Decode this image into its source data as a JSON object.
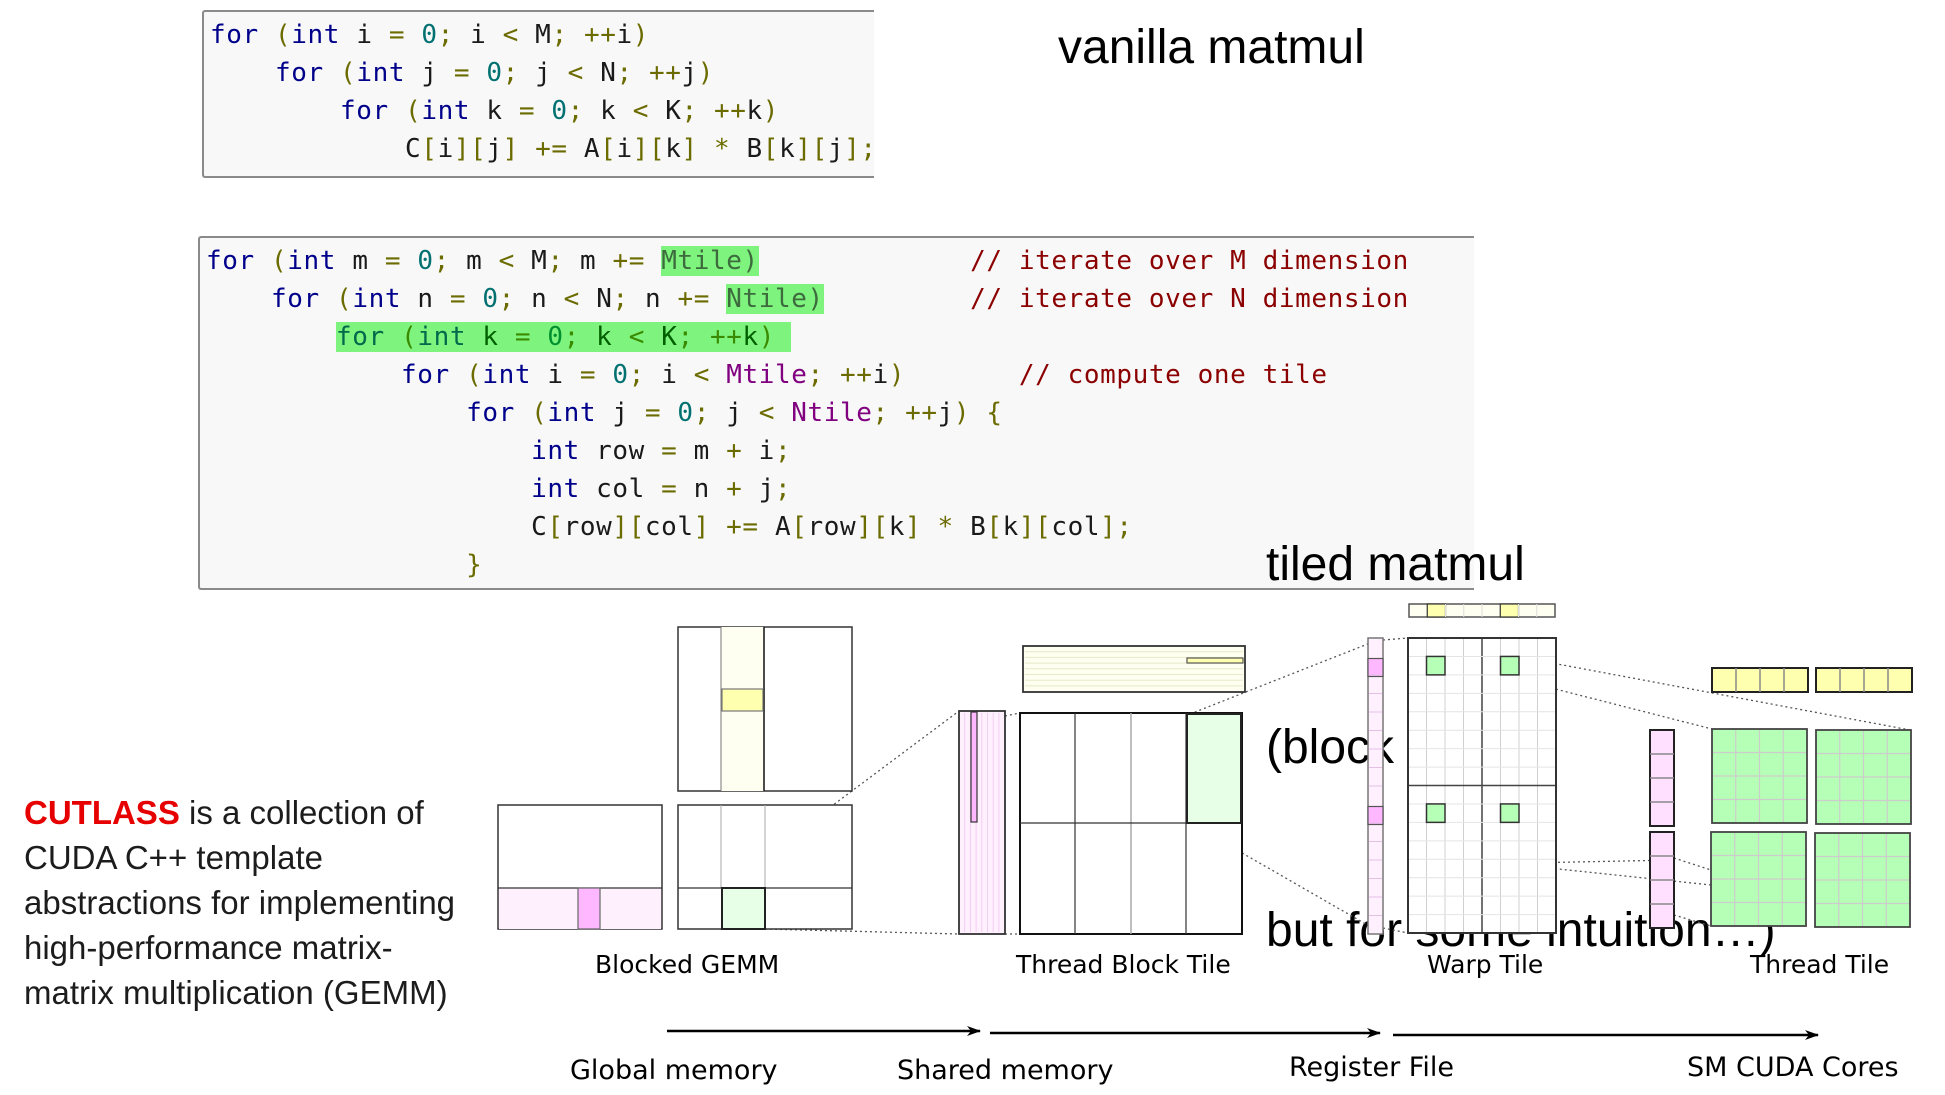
{
  "vanilla": {
    "title": "vanilla matmul",
    "code": [
      [
        [
          "kw",
          "for"
        ],
        [
          "var",
          " "
        ],
        [
          "pn",
          "("
        ],
        [
          "kw",
          "int"
        ],
        [
          "var",
          " i "
        ],
        [
          "pn",
          "="
        ],
        [
          "var",
          " "
        ],
        [
          "num",
          "0"
        ],
        [
          "pn",
          ";"
        ],
        [
          "var",
          " i "
        ],
        [
          "pn",
          "<"
        ],
        [
          "var",
          " M"
        ],
        [
          "pn",
          ";"
        ],
        [
          "var",
          " "
        ],
        [
          "pn",
          "++"
        ],
        [
          "var",
          "i"
        ],
        [
          "pn",
          ")"
        ]
      ],
      [
        [
          "var",
          "    "
        ],
        [
          "kw",
          "for"
        ],
        [
          "var",
          " "
        ],
        [
          "pn",
          "("
        ],
        [
          "kw",
          "int"
        ],
        [
          "var",
          " j "
        ],
        [
          "pn",
          "="
        ],
        [
          "var",
          " "
        ],
        [
          "num",
          "0"
        ],
        [
          "pn",
          ";"
        ],
        [
          "var",
          " j "
        ],
        [
          "pn",
          "<"
        ],
        [
          "var",
          " N"
        ],
        [
          "pn",
          ";"
        ],
        [
          "var",
          " "
        ],
        [
          "pn",
          "++"
        ],
        [
          "var",
          "j"
        ],
        [
          "pn",
          ")"
        ]
      ],
      [
        [
          "var",
          "        "
        ],
        [
          "kw",
          "for"
        ],
        [
          "var",
          " "
        ],
        [
          "pn",
          "("
        ],
        [
          "kw",
          "int"
        ],
        [
          "var",
          " k "
        ],
        [
          "pn",
          "="
        ],
        [
          "var",
          " "
        ],
        [
          "num",
          "0"
        ],
        [
          "pn",
          ";"
        ],
        [
          "var",
          " k "
        ],
        [
          "pn",
          "<"
        ],
        [
          "var",
          " K"
        ],
        [
          "pn",
          ";"
        ],
        [
          "var",
          " "
        ],
        [
          "pn",
          "++"
        ],
        [
          "var",
          "k"
        ],
        [
          "pn",
          ")"
        ]
      ],
      [
        [
          "var",
          "            C"
        ],
        [
          "pn",
          "["
        ],
        [
          "var",
          "i"
        ],
        [
          "pn",
          "]["
        ],
        [
          "var",
          "j"
        ],
        [
          "pn",
          "]"
        ],
        [
          "var",
          " "
        ],
        [
          "pn",
          "+="
        ],
        [
          "var",
          " A"
        ],
        [
          "pn",
          "["
        ],
        [
          "var",
          "i"
        ],
        [
          "pn",
          "]["
        ],
        [
          "var",
          "k"
        ],
        [
          "pn",
          "]"
        ],
        [
          "var",
          " "
        ],
        [
          "pn",
          "*"
        ],
        [
          "var",
          " B"
        ],
        [
          "pn",
          "["
        ],
        [
          "var",
          "k"
        ],
        [
          "pn",
          "]["
        ],
        [
          "var",
          "j"
        ],
        [
          "pn",
          "];"
        ]
      ]
    ]
  },
  "tiled": {
    "title_lines": [
      "tiled matmul",
      "(block != tile,",
      "but for some intuition…)"
    ],
    "code": [
      [
        [
          "kw",
          "for"
        ],
        [
          "var",
          " "
        ],
        [
          "pn",
          "("
        ],
        [
          "kw",
          "int"
        ],
        [
          "var",
          " m "
        ],
        [
          "pn",
          "="
        ],
        [
          "var",
          " "
        ],
        [
          "num",
          "0"
        ],
        [
          "pn",
          ";"
        ],
        [
          "var",
          " m "
        ],
        [
          "pn",
          "<"
        ],
        [
          "var",
          " M"
        ],
        [
          "pn",
          ";"
        ],
        [
          "var",
          " m "
        ],
        [
          "pn",
          "+="
        ],
        [
          "var",
          " "
        ],
        [
          "hl",
          "Mtile)"
        ],
        [
          "var",
          "             "
        ],
        [
          "cm",
          "// iterate over M dimension"
        ]
      ],
      [
        [
          "var",
          "    "
        ],
        [
          "kw",
          "for"
        ],
        [
          "var",
          " "
        ],
        [
          "pn",
          "("
        ],
        [
          "kw",
          "int"
        ],
        [
          "var",
          " n "
        ],
        [
          "pn",
          "="
        ],
        [
          "var",
          " "
        ],
        [
          "num",
          "0"
        ],
        [
          "pn",
          ";"
        ],
        [
          "var",
          " n "
        ],
        [
          "pn",
          "<"
        ],
        [
          "var",
          " N"
        ],
        [
          "pn",
          ";"
        ],
        [
          "var",
          " n "
        ],
        [
          "pn",
          "+="
        ],
        [
          "var",
          " "
        ],
        [
          "hl",
          "Ntile)"
        ],
        [
          "var",
          "         "
        ],
        [
          "cm",
          "// iterate over N dimension"
        ]
      ],
      [
        [
          "var",
          "        "
        ],
        [
          "hlline",
          "for (int k = 0; k < K; ++k) "
        ]
      ],
      [
        [
          "var",
          "            "
        ],
        [
          "kw",
          "for"
        ],
        [
          "var",
          " "
        ],
        [
          "pn",
          "("
        ],
        [
          "kw",
          "int"
        ],
        [
          "var",
          " i "
        ],
        [
          "pn",
          "="
        ],
        [
          "var",
          " "
        ],
        [
          "num",
          "0"
        ],
        [
          "pn",
          ";"
        ],
        [
          "var",
          " i "
        ],
        [
          "pn",
          "<"
        ],
        [
          "var",
          " "
        ],
        [
          "mvar",
          "Mtile"
        ],
        [
          "pn",
          ";"
        ],
        [
          "var",
          " "
        ],
        [
          "pn",
          "++"
        ],
        [
          "var",
          "i"
        ],
        [
          "pn",
          ")"
        ],
        [
          "var",
          "       "
        ],
        [
          "cm",
          "// compute one tile"
        ]
      ],
      [
        [
          "var",
          "                "
        ],
        [
          "kw",
          "for"
        ],
        [
          "var",
          " "
        ],
        [
          "pn",
          "("
        ],
        [
          "kw",
          "int"
        ],
        [
          "var",
          " j "
        ],
        [
          "pn",
          "="
        ],
        [
          "var",
          " "
        ],
        [
          "num",
          "0"
        ],
        [
          "pn",
          ";"
        ],
        [
          "var",
          " j "
        ],
        [
          "pn",
          "<"
        ],
        [
          "var",
          " "
        ],
        [
          "mvar",
          "Ntile"
        ],
        [
          "pn",
          ";"
        ],
        [
          "var",
          " "
        ],
        [
          "pn",
          "++"
        ],
        [
          "var",
          "j"
        ],
        [
          "pn",
          ")"
        ],
        [
          "var",
          " "
        ],
        [
          "pn",
          "{"
        ]
      ],
      [
        [
          "var",
          "                    "
        ],
        [
          "kw",
          "int"
        ],
        [
          "var",
          " row "
        ],
        [
          "pn",
          "="
        ],
        [
          "var",
          " m "
        ],
        [
          "pn",
          "+"
        ],
        [
          "var",
          " i"
        ],
        [
          "pn",
          ";"
        ]
      ],
      [
        [
          "var",
          "                    "
        ],
        [
          "kw",
          "int"
        ],
        [
          "var",
          " col "
        ],
        [
          "pn",
          "="
        ],
        [
          "var",
          " n "
        ],
        [
          "pn",
          "+"
        ],
        [
          "var",
          " j"
        ],
        [
          "pn",
          ";"
        ]
      ],
      [
        [
          "var",
          "                    C"
        ],
        [
          "pn",
          "["
        ],
        [
          "var",
          "row"
        ],
        [
          "pn",
          "]["
        ],
        [
          "var",
          "col"
        ],
        [
          "pn",
          "]"
        ],
        [
          "var",
          " "
        ],
        [
          "pn",
          "+="
        ],
        [
          "var",
          " A"
        ],
        [
          "pn",
          "["
        ],
        [
          "var",
          "row"
        ],
        [
          "pn",
          "]["
        ],
        [
          "var",
          "k"
        ],
        [
          "pn",
          "]"
        ],
        [
          "var",
          " "
        ],
        [
          "pn",
          "*"
        ],
        [
          "var",
          " B"
        ],
        [
          "pn",
          "["
        ],
        [
          "var",
          "k"
        ],
        [
          "pn",
          "]["
        ],
        [
          "var",
          "col"
        ],
        [
          "pn",
          "];"
        ]
      ],
      [
        [
          "var",
          "                "
        ],
        [
          "pn",
          "}"
        ]
      ]
    ]
  },
  "description": {
    "brand": "CUTLASS",
    "text": " is a collection of CUDA C++ template abstractions for implementing high-performance matrix-matrix multiplication (GEMM)"
  },
  "diagram": {
    "captions": {
      "blocked_gemm": "Blocked GEMM",
      "thread_block_tile": "Thread Block Tile",
      "warp_tile": "Warp Tile",
      "thread_tile": "Thread Tile"
    },
    "memory_levels": [
      "Global memory",
      "Shared memory",
      "Register File",
      "SM CUDA Cores"
    ],
    "colors": {
      "a_fill_light": "#fff0fe",
      "a_fill": "#ffb8ff",
      "b_fill_light": "#fefff0",
      "b_fill": "#ffffb0",
      "c_fill_light": "#e6ffe6",
      "c_fill": "#b6ffb6"
    }
  }
}
